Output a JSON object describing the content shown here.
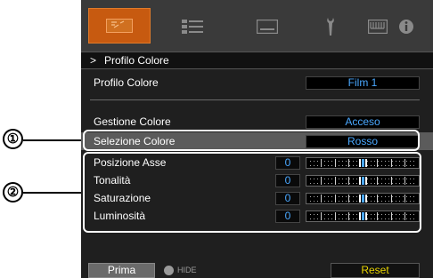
{
  "tabs": [
    {
      "icon": "picture-adjust-icon"
    },
    {
      "icon": "input-settings-icon"
    },
    {
      "icon": "installation-icon"
    },
    {
      "icon": "function-icon"
    },
    {
      "icon": "display-setup-icon"
    },
    {
      "icon": "information-icon"
    }
  ],
  "header": {
    "chevron": ">",
    "title": "Profilo Colore"
  },
  "rows": {
    "profilo": {
      "label": "Profilo Colore",
      "value": "Film 1"
    },
    "gestione": {
      "label": "Gestione Colore",
      "value": "Acceso"
    },
    "selezione": {
      "label": "Selezione Colore",
      "value": "Rosso"
    }
  },
  "sliders": [
    {
      "label": "Posizione Asse",
      "value": "0",
      "level": 0.5
    },
    {
      "label": "Tonalità",
      "value": "0",
      "level": 0.5
    },
    {
      "label": "Saturazione",
      "value": "0",
      "level": 0.5
    },
    {
      "label": "Luminosità",
      "value": "0",
      "level": 0.5
    }
  ],
  "footer": {
    "prima": "Prima",
    "hide": "HIDE",
    "reset": "Reset"
  },
  "callouts": [
    "①",
    "②"
  ],
  "colors": {
    "accent": "#c75a10",
    "value": "#4aa8ff",
    "reset": "#e8d400"
  }
}
